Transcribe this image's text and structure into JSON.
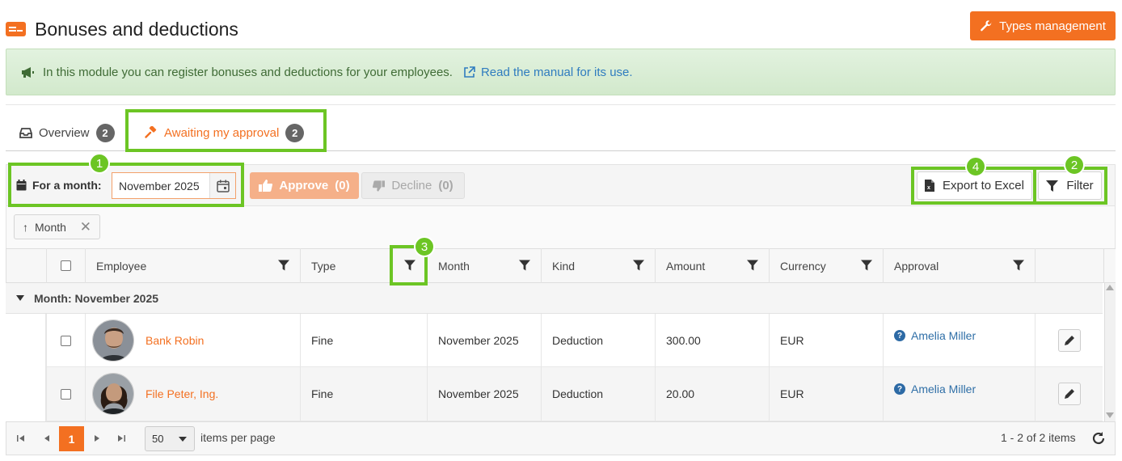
{
  "header": {
    "title": "Bonuses and deductions",
    "types_button": "Types management"
  },
  "info": {
    "message": "In this module you can register bonuses and deductions for your employees.",
    "manual_link": "Read the manual for its use."
  },
  "tabs": [
    {
      "label": "Overview",
      "count": "2",
      "active": false
    },
    {
      "label": "Awaiting my approval",
      "count": "2",
      "active": true
    }
  ],
  "toolbar": {
    "month_label": "For a month:",
    "month_value": "November 2025",
    "approve_label": "Approve",
    "approve_count": "(0)",
    "decline_label": "Decline",
    "decline_count": "(0)",
    "export_label": "Export to Excel",
    "filter_label": "Filter"
  },
  "grouping": {
    "chip_label": "Month"
  },
  "grid": {
    "columns": [
      "Employee",
      "Type",
      "Month",
      "Kind",
      "Amount",
      "Currency",
      "Approval"
    ],
    "group_label": "Month: November 2025",
    "rows": [
      {
        "employee": "Bank Robin",
        "type": "Fine",
        "month": "November 2025",
        "kind": "Deduction",
        "amount": "300.00",
        "currency": "EUR",
        "approval": "Amelia Miller"
      },
      {
        "employee": "File Peter, Ing.",
        "type": "Fine",
        "month": "November 2025",
        "kind": "Deduction",
        "amount": "20.00",
        "currency": "EUR",
        "approval": "Amelia Miller"
      }
    ]
  },
  "pager": {
    "current_page": "1",
    "page_size": "50",
    "items_per_page_label": "items per page",
    "info": "1 - 2 of 2 items"
  },
  "annotations": [
    "1",
    "2",
    "3",
    "4"
  ],
  "colors": {
    "accent": "#f37021",
    "highlight": "#6cc524",
    "link": "#2f7cbf"
  }
}
